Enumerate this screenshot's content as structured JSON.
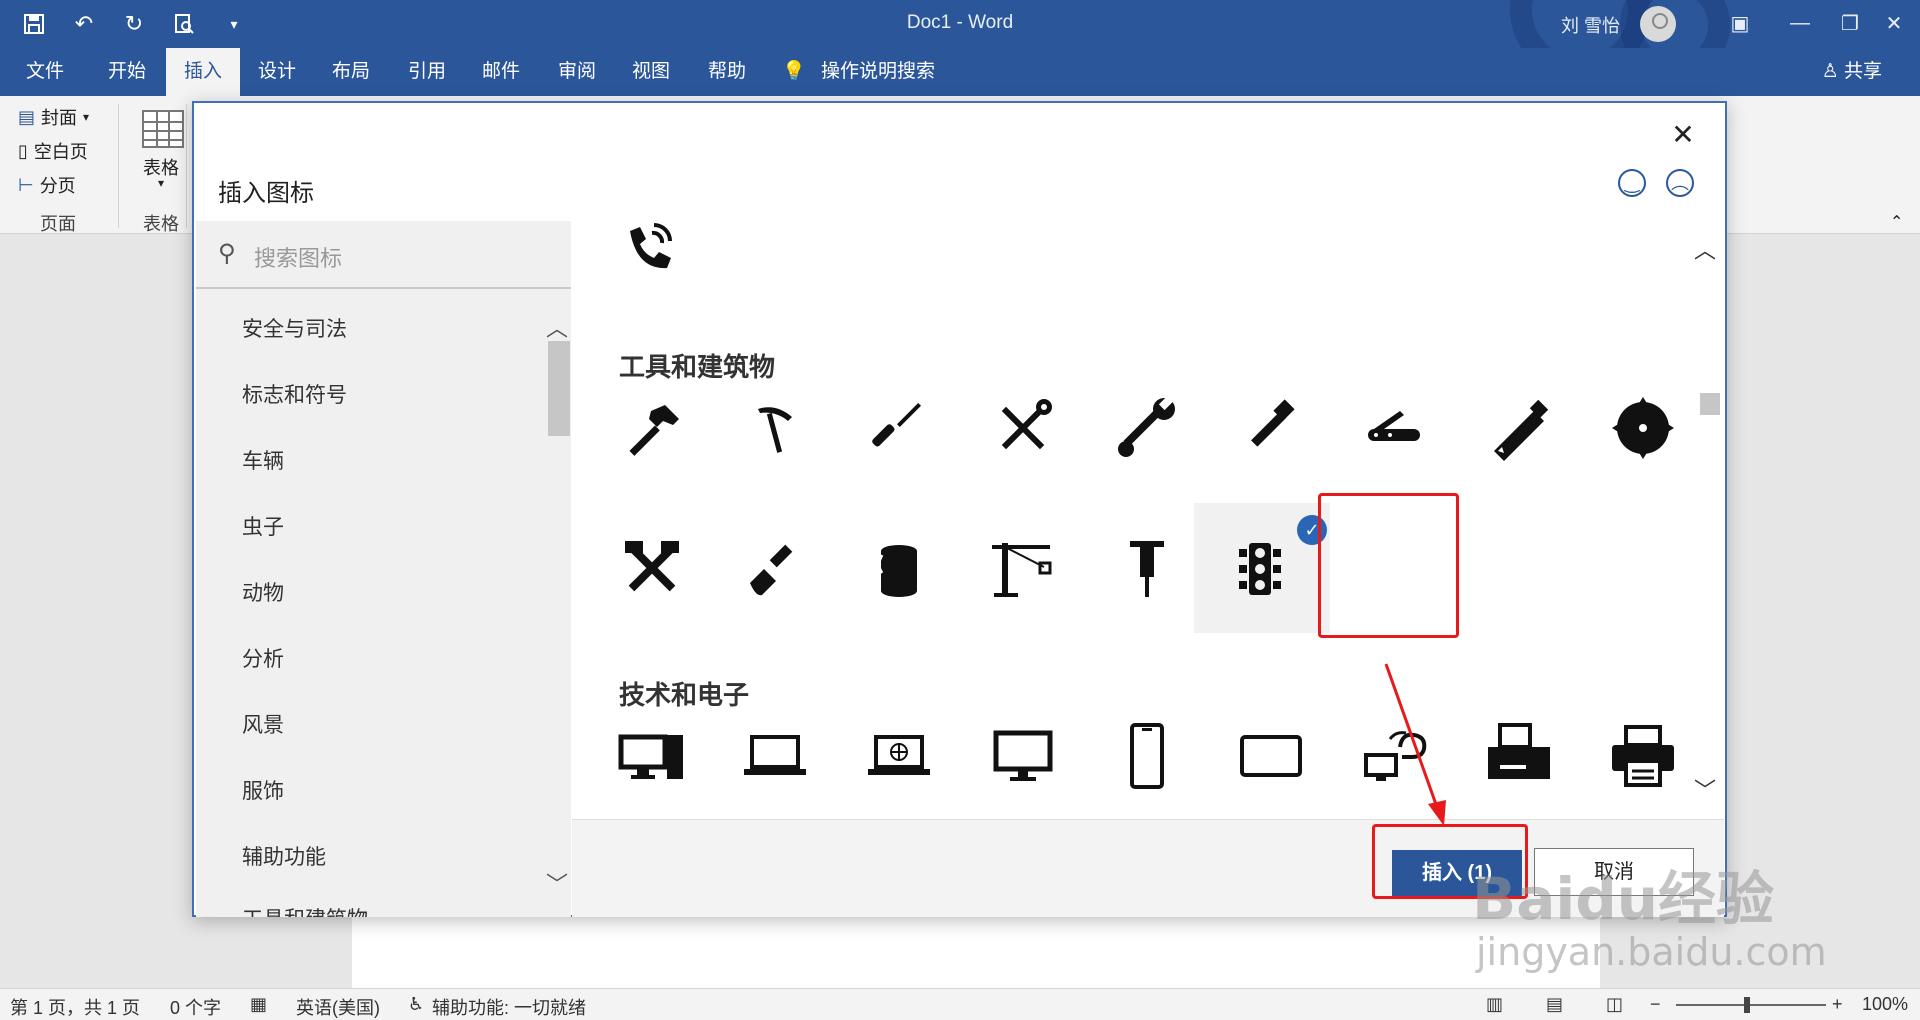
{
  "window": {
    "title": "Doc1  -  Word",
    "user": "刘 雪怡",
    "controls": [
      "restore-ribbon-icon",
      "minimize-icon",
      "maximize-icon",
      "close-icon"
    ]
  },
  "qat": {
    "icons": [
      "save-icon",
      "undo-icon",
      "redo-icon",
      "print-preview-icon",
      "customize-icon"
    ]
  },
  "tabs": [
    {
      "label": "文件"
    },
    {
      "label": "开始"
    },
    {
      "label": "插入"
    },
    {
      "label": "设计"
    },
    {
      "label": "布局"
    },
    {
      "label": "引用"
    },
    {
      "label": "邮件"
    },
    {
      "label": "审阅"
    },
    {
      "label": "视图"
    },
    {
      "label": "帮助"
    }
  ],
  "tell_me": "操作说明搜索",
  "share": "共享",
  "ribbon": {
    "pages": {
      "cover": "封面",
      "blank": "空白页",
      "break": "分页",
      "group": "页面"
    },
    "tables": {
      "table": "表格",
      "group": "表格"
    }
  },
  "dialog": {
    "title": "插入图标",
    "search_placeholder": "搜索图标",
    "categories": [
      "安全与司法",
      "标志和符号",
      "车辆",
      "虫子",
      "动物",
      "分析",
      "风景",
      "服饰",
      "辅助功能",
      "工具和建筑物"
    ],
    "sections": {
      "tools": "工具和建筑物",
      "tech": "技术和电子"
    },
    "insert_label": "插入 (1)",
    "cancel_label": "取消"
  },
  "status": {
    "page": "第 1 页，共 1 页",
    "words": "0 个字",
    "lang": "英语(美国)",
    "accessibility": "辅助功能: 一切就绪",
    "zoom": "100%"
  },
  "watermark": {
    "logo": "Baidu经验",
    "url": "jingyan.baidu.com"
  },
  "colors": {
    "accent": "#2b579a",
    "highlight": "#e8191a"
  }
}
